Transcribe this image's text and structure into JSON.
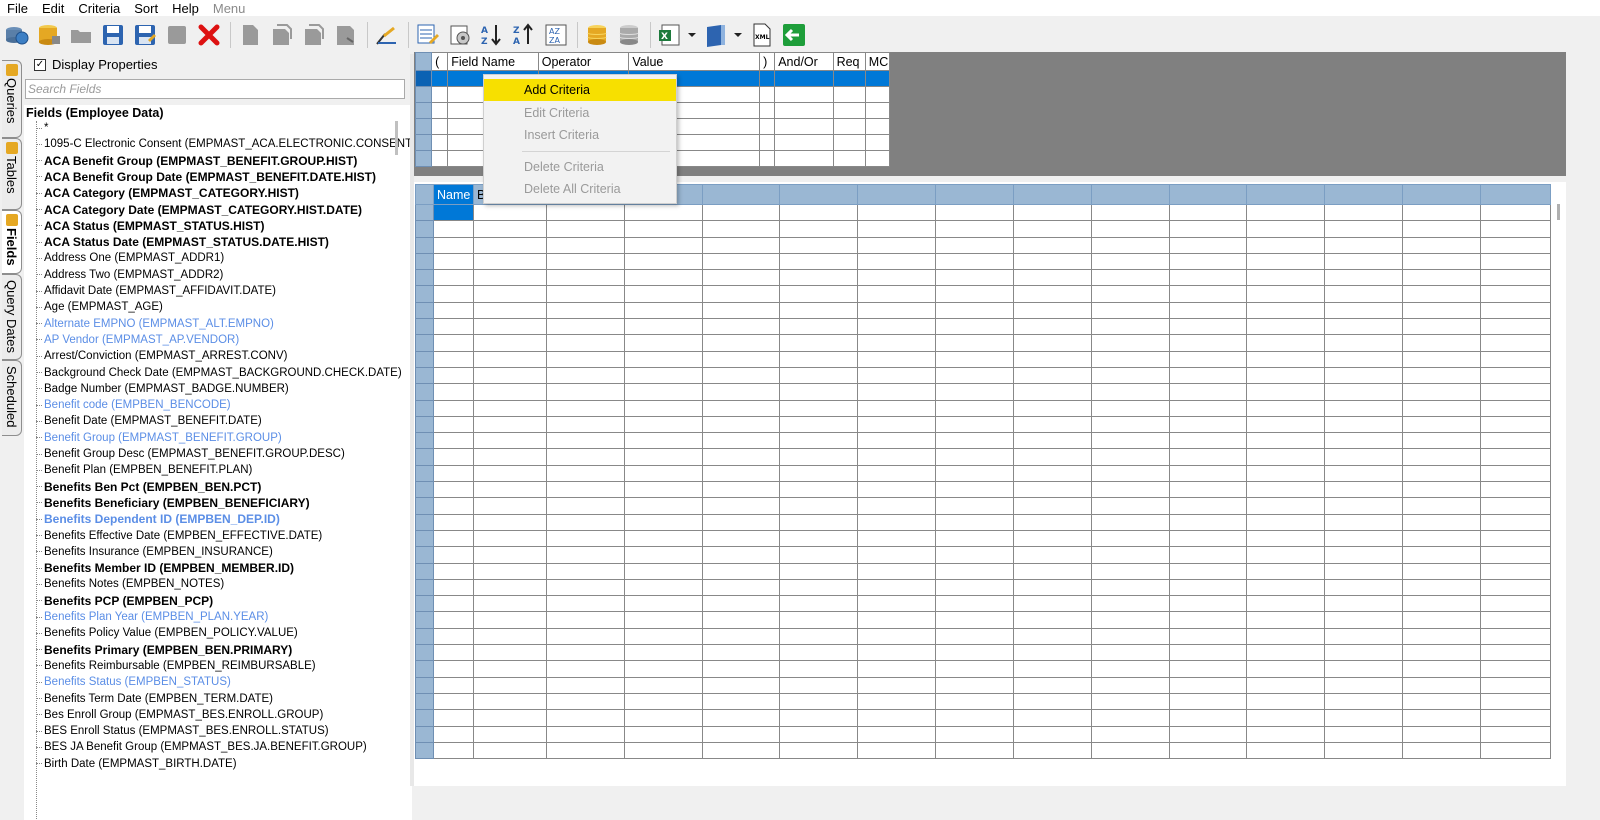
{
  "menu": {
    "file": "File",
    "edit": "Edit",
    "criteria": "Criteria",
    "sort": "Sort",
    "help": "Help",
    "menu": "Menu"
  },
  "toolbar": {
    "icons": [
      "globe-database-icon",
      "database-icon",
      "folder-icon",
      "save-icon",
      "save-as-icon",
      "blank-disk-icon",
      "delete-icon",
      "new-page-icon",
      "copy-icon",
      "paste-icon",
      "export-icon",
      "tools-icon",
      "edit-grid-icon",
      "settings-icon",
      "sort-ascending-icon",
      "sort-descending-icon",
      "sort-az-icon",
      "database-gold-icon",
      "database-gray-icon",
      "excel-export-icon",
      "report-icon",
      "xml-export-icon",
      "exit-icon"
    ]
  },
  "side_tabs": {
    "queries": "Queries",
    "tables": "Tables",
    "fields": "Fields",
    "query_dates": "Query Dates",
    "scheduled": "Scheduled"
  },
  "left": {
    "display_properties": "Display Properties",
    "display_properties_checked": "✓",
    "search_placeholder": "Search Fields",
    "tree_root": "Fields (Employee Data)",
    "fields": [
      {
        "label": "*",
        "style": "normal"
      },
      {
        "label": "1095-C Electronic Consent (EMPMAST_ACA.ELECTRONIC.CONSENT)",
        "style": "normal"
      },
      {
        "label": "ACA Benefit Group (EMPMAST_BENEFIT.GROUP.HIST)",
        "style": "bold"
      },
      {
        "label": "ACA Benefit Group Date (EMPMAST_BENEFIT.DATE.HIST)",
        "style": "bold"
      },
      {
        "label": "ACA Category (EMPMAST_CATEGORY.HIST)",
        "style": "bold"
      },
      {
        "label": "ACA Category Date (EMPMAST_CATEGORY.HIST.DATE)",
        "style": "bold"
      },
      {
        "label": "ACA Status (EMPMAST_STATUS.HIST)",
        "style": "bold"
      },
      {
        "label": "ACA Status Date (EMPMAST_STATUS.DATE.HIST)",
        "style": "bold"
      },
      {
        "label": "Address One (EMPMAST_ADDR1)",
        "style": "normal"
      },
      {
        "label": "Address Two (EMPMAST_ADDR2)",
        "style": "normal"
      },
      {
        "label": "Affidavit Date (EMPMAST_AFFIDAVIT.DATE)",
        "style": "normal"
      },
      {
        "label": "Age (EMPMAST_AGE)",
        "style": "normal"
      },
      {
        "label": "Alternate EMPNO (EMPMAST_ALT.EMPNO)",
        "style": "blue"
      },
      {
        "label": "AP Vendor (EMPMAST_AP.VENDOR)",
        "style": "blue"
      },
      {
        "label": "Arrest/Conviction (EMPMAST_ARREST.CONV)",
        "style": "normal"
      },
      {
        "label": "Background Check Date (EMPMAST_BACKGROUND.CHECK.DATE)",
        "style": "normal"
      },
      {
        "label": "Badge Number (EMPMAST_BADGE.NUMBER)",
        "style": "normal"
      },
      {
        "label": "Benefit code (EMPBEN_BENCODE)",
        "style": "blue"
      },
      {
        "label": "Benefit Date (EMPMAST_BENEFIT.DATE)",
        "style": "normal"
      },
      {
        "label": "Benefit Group (EMPMAST_BENEFIT.GROUP)",
        "style": "blue"
      },
      {
        "label": "Benefit Group Desc (EMPMAST_BENEFIT.GROUP.DESC)",
        "style": "normal"
      },
      {
        "label": "Benefit Plan (EMPBEN_BENEFIT.PLAN)",
        "style": "normal"
      },
      {
        "label": "Benefits Ben Pct (EMPBEN_BEN.PCT)",
        "style": "bold"
      },
      {
        "label": "Benefits Beneficiary (EMPBEN_BENEFICIARY)",
        "style": "bold"
      },
      {
        "label": "Benefits Dependent ID (EMPBEN_DEP.ID)",
        "style": "boldblue"
      },
      {
        "label": "Benefits Effective Date (EMPBEN_EFFECTIVE.DATE)",
        "style": "normal"
      },
      {
        "label": "Benefits Insurance (EMPBEN_INSURANCE)",
        "style": "normal"
      },
      {
        "label": "Benefits Member ID (EMPBEN_MEMBER.ID)",
        "style": "bold"
      },
      {
        "label": "Benefits Notes (EMPBEN_NOTES)",
        "style": "normal"
      },
      {
        "label": "Benefits PCP (EMPBEN_PCP)",
        "style": "bold"
      },
      {
        "label": "Benefits Plan Year (EMPBEN_PLAN.YEAR)",
        "style": "blue"
      },
      {
        "label": "Benefits Policy Value (EMPBEN_POLICY.VALUE)",
        "style": "normal"
      },
      {
        "label": "Benefits Primary (EMPBEN_BEN.PRIMARY)",
        "style": "bold"
      },
      {
        "label": "Benefits Reimbursable (EMPBEN_REIMBURSABLE)",
        "style": "normal"
      },
      {
        "label": "Benefits Status (EMPBEN_STATUS)",
        "style": "blue"
      },
      {
        "label": "Benefits Term Date (EMPBEN_TERM.DATE)",
        "style": "normal"
      },
      {
        "label": "Bes Enroll Group (EMPMAST_BES.ENROLL.GROUP)",
        "style": "normal"
      },
      {
        "label": "BES Enroll Status (EMPMAST_BES.ENROLL.STATUS)",
        "style": "normal"
      },
      {
        "label": "BES JA Benefit Group (EMPMAST_BES.JA.BENEFIT.GROUP)",
        "style": "normal"
      },
      {
        "label": "Birth Date (EMPMAST_BIRTH.DATE)",
        "style": "normal"
      }
    ]
  },
  "criteria_grid": {
    "headers": [
      "(",
      "Field Name",
      "Operator",
      "Value",
      ")",
      "And/Or",
      "Req",
      "MC"
    ]
  },
  "results_grid": {
    "headers": [
      "Name",
      "B",
      "",
      "",
      "",
      "",
      "",
      "",
      "",
      "",
      "",
      "",
      "",
      "",
      ""
    ]
  },
  "context_menu": {
    "add": "Add Criteria",
    "edit": "Edit Criteria",
    "insert": "Insert Criteria",
    "delete": "Delete Criteria",
    "delete_all": "Delete All Criteria"
  },
  "colors": {
    "accent": "#0078d7",
    "row_header": "#9ab7d3",
    "highlight": "#f7e000",
    "link_blue": "#5b8ee6"
  }
}
